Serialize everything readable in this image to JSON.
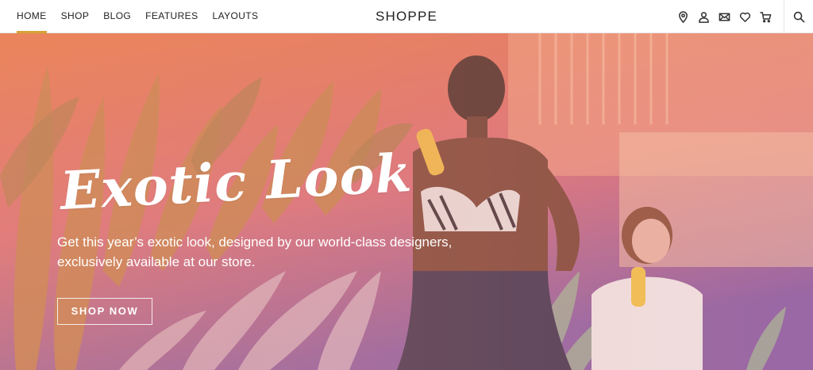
{
  "header": {
    "nav": [
      {
        "label": "HOME",
        "active": true
      },
      {
        "label": "SHOP"
      },
      {
        "label": "BLOG"
      },
      {
        "label": "FEATURES"
      },
      {
        "label": "LAYOUTS"
      }
    ],
    "brand": "SHOPPE",
    "icons": [
      "location-pin-icon",
      "user-icon",
      "mail-icon",
      "heart-icon",
      "cart-icon",
      "search-icon"
    ],
    "accent": "#d4a437"
  },
  "hero": {
    "title": "Exotic Look",
    "description": "Get this year’s exotic look, designed by our world-class designers, exclusively available at our store.",
    "cta": "SHOP NOW",
    "gradient": [
      "#e8764a",
      "#d96a7d",
      "#8a5aa8"
    ]
  }
}
